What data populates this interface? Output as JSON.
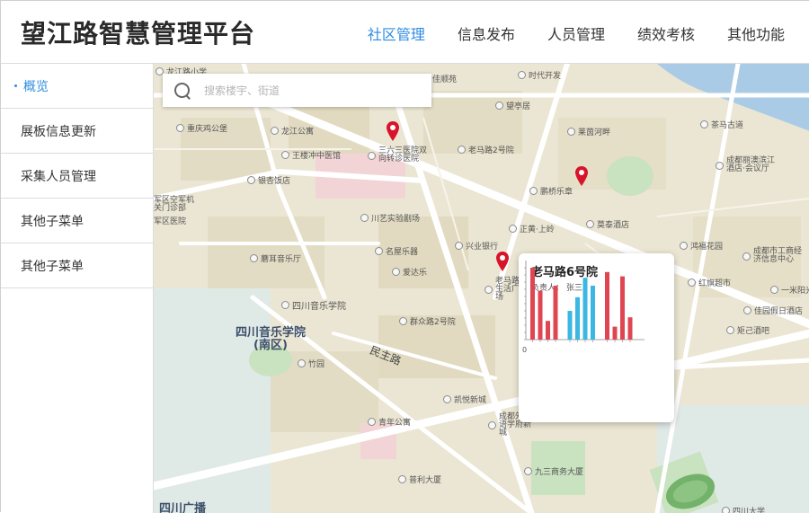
{
  "header": {
    "title": "望江路智慧管理平台",
    "nav": [
      {
        "label": "社区管理",
        "active": true
      },
      {
        "label": "信息发布",
        "active": false
      },
      {
        "label": "人员管理",
        "active": false
      },
      {
        "label": "绩效考核",
        "active": false
      },
      {
        "label": "其他功能",
        "active": false
      }
    ]
  },
  "sidebar": {
    "items": [
      {
        "label": "概览",
        "active": true
      },
      {
        "label": "展板信息更新",
        "active": false
      },
      {
        "label": "采集人员管理",
        "active": false
      },
      {
        "label": "其他子菜单",
        "active": false
      },
      {
        "label": "其他子菜单",
        "active": false
      }
    ]
  },
  "search": {
    "placeholder": "搜索楼宇、街道"
  },
  "map": {
    "pois": {
      "p1": "龙江路小学",
      "p2": "佳顺苑",
      "p3": "时代开发",
      "p4": "望亭居",
      "p5": "重庆鸡公堡",
      "p6": "龙江公寓",
      "p7": "茶马古道",
      "p8": "莱茵河畔",
      "p9": "王楼冲中医馆",
      "p10": "三六三医院双向转诊医院",
      "p11": "老马路2号院",
      "p12": "成都丽澳滨江酒店·会议厅",
      "p13": "银杏饭店",
      "p14": "鹏桥乐章",
      "p15": "军区空军机关门诊部",
      "p16": "川艺实验剧场",
      "p17": "莫泰酒店",
      "p18": "正黄·上岭",
      "p19": "名屋乐器",
      "p20": "兴业银行",
      "p21": "鸿福花园",
      "p22": "成都市工商经济信息中心",
      "p23": "蘑耳音乐厅",
      "p24": "爱达乐",
      "p25": "红旗超市",
      "p26": "一米阳光",
      "p27": "老马路生活广场",
      "p28": "四川音乐学院",
      "p29": "佳园假日酒店",
      "p30": "群众路2号院",
      "p31": "矩己酒吧",
      "p32": "四川音乐学院(南区)",
      "p33": "竹园",
      "p34": "民主路",
      "p35": "凯悦新城",
      "p36": "青年公寓",
      "p37": "成都外国语学府新城",
      "p38": "九三商务大厦",
      "p39": "普利大厦",
      "p40": "四川广播",
      "p41": "四川大学",
      "p42": "军区医院"
    }
  },
  "popup": {
    "title": "老马路6号院",
    "owner_label": "负责人：",
    "owner_name": "张三",
    "chart_zero": "0"
  },
  "colors": {
    "accent": "#2d8ce0",
    "marker": "#d8142a",
    "bar_red": "#e04652",
    "bar_blue": "#3ab7e2"
  },
  "chart_data": {
    "type": "bar",
    "ylim": [
      0,
      10
    ],
    "series": [
      {
        "values": [
          10,
          6.8,
          2.6,
          7.5
        ],
        "color": "red"
      },
      {
        "values": [
          4,
          5.9,
          8.6,
          7.5
        ],
        "color": "blue"
      },
      {
        "values": [
          9.4,
          1.8,
          8.8,
          3.1
        ],
        "color": "red"
      }
    ]
  }
}
